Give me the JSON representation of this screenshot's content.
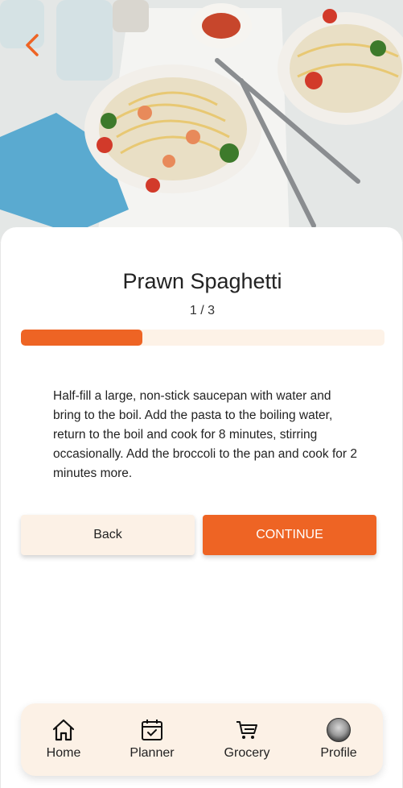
{
  "recipe": {
    "title": "Prawn Spaghetti",
    "step_label": "1 / 3",
    "progress_fraction": 0.333,
    "instructions": "Half-fill a large, non-stick saucepan with water and bring to the boil. Add the pasta to the boiling water, return to the boil and cook for 8 minutes, stirring occasionally. Add the broccoli to the pan and cook for 2 minutes more."
  },
  "buttons": {
    "back_label": "Back",
    "continue_label": "CONTINUE"
  },
  "nav": {
    "items": [
      {
        "label": "Home",
        "icon": "home-icon"
      },
      {
        "label": "Planner",
        "icon": "calendar-icon"
      },
      {
        "label": "Grocery",
        "icon": "cart-icon"
      },
      {
        "label": "Profile",
        "icon": "avatar"
      }
    ]
  },
  "colors": {
    "accent": "#ee6424",
    "soft": "#fcf1e6",
    "track": "#fdf2e7"
  }
}
